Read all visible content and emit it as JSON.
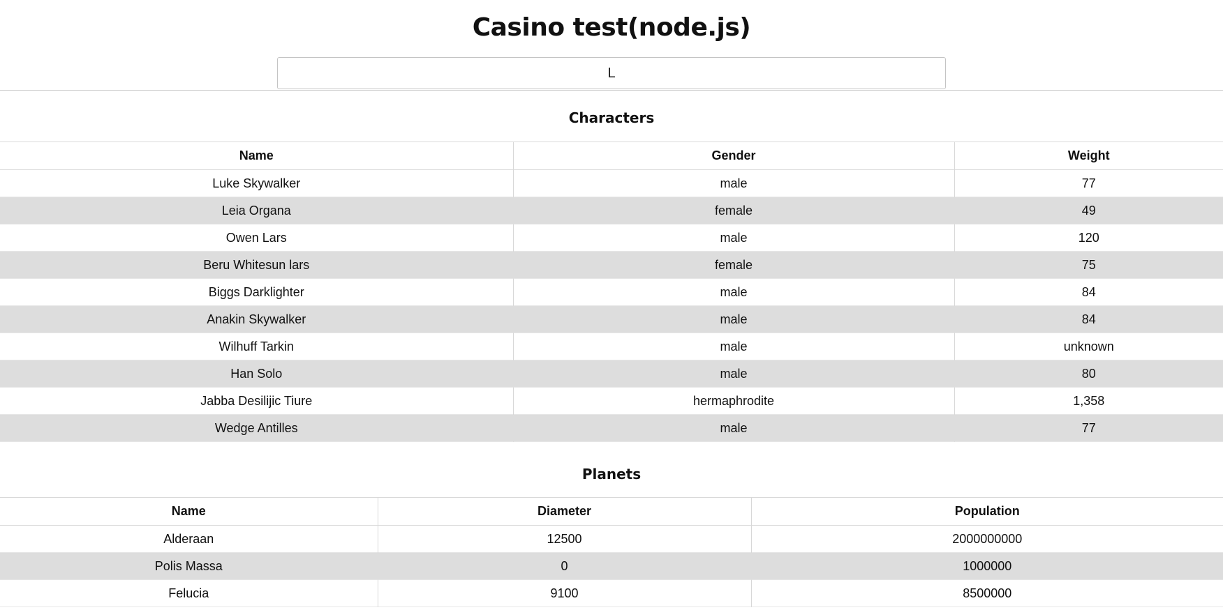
{
  "app": {
    "title": "Casino test(node.js)"
  },
  "search": {
    "value": "L",
    "placeholder": ""
  },
  "characters": {
    "title": "Characters",
    "columns": [
      "Name",
      "Gender",
      "Weight"
    ],
    "rows": [
      [
        "Luke Skywalker",
        "male",
        "77"
      ],
      [
        "Leia Organa",
        "female",
        "49"
      ],
      [
        "Owen Lars",
        "male",
        "120"
      ],
      [
        "Beru Whitesun lars",
        "female",
        "75"
      ],
      [
        "Biggs Darklighter",
        "male",
        "84"
      ],
      [
        "Anakin Skywalker",
        "male",
        "84"
      ],
      [
        "Wilhuff Tarkin",
        "male",
        "unknown"
      ],
      [
        "Han Solo",
        "male",
        "80"
      ],
      [
        "Jabba Desilijic Tiure",
        "hermaphrodite",
        "1,358"
      ],
      [
        "Wedge Antilles",
        "male",
        "77"
      ]
    ]
  },
  "planets": {
    "title": "Planets",
    "columns": [
      "Name",
      "Diameter",
      "Population"
    ],
    "rows": [
      [
        "Alderaan",
        "12500",
        "2000000000"
      ],
      [
        "Polis Massa",
        "0",
        "1000000"
      ],
      [
        "Felucia",
        "9100",
        "8500000"
      ]
    ]
  }
}
